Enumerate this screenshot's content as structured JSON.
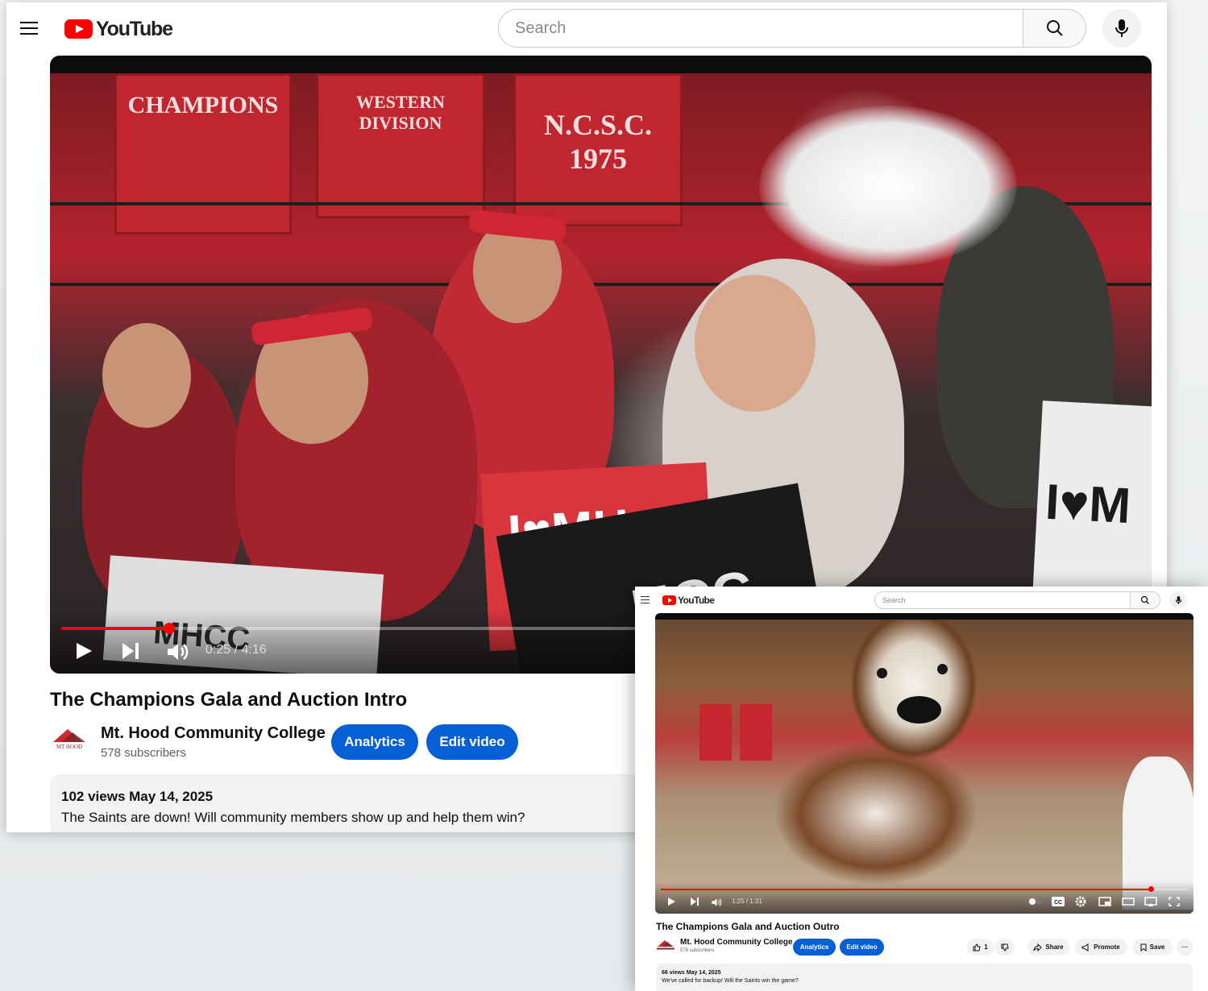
{
  "main_window": {
    "app": {
      "logo_text": "YouTube"
    },
    "search": {
      "placeholder": "Search"
    },
    "player": {
      "time_display": "0:25 / 4:16",
      "progress": 0.1
    },
    "video": {
      "title": "The Champions Gala and Auction Intro",
      "channel_name": "Mt. Hood Community College",
      "subscribers": "578 subscribers",
      "analytics_label": "Analytics",
      "edit_label": "Edit video",
      "meta": "102 views  May 14, 2025",
      "description": "The Saints are down! Will community members show up and help them win?"
    },
    "scene_text": {
      "banner1": "CHAMPIONS",
      "banner2": "WESTERN DIVISION",
      "banner3": "N.C.S.C. 1975",
      "sign1": "I♥MH",
      "sign2": "HCC",
      "sign3": "I♥M",
      "sign4": "MHCC"
    }
  },
  "overlay_window": {
    "app": {
      "logo_text": "YouTube"
    },
    "search": {
      "placeholder": "Search"
    },
    "player": {
      "time_display": "1:25 / 1:31",
      "progress": 0.93,
      "cc_label": "CC"
    },
    "video": {
      "title": "The Champions Gala and Auction Outro",
      "channel_name": "Mt. Hood Community College",
      "subscribers": "578 subscribers",
      "analytics_label": "Analytics",
      "edit_label": "Edit video",
      "likes": "1",
      "share_label": "Share",
      "promote_label": "Promote",
      "save_label": "Save",
      "more_label": "···",
      "meta": "66 views  May 14, 2025",
      "description": "We've called for backup! Will the Saints win the game?"
    }
  },
  "colors": {
    "brand_red": "#ff0000",
    "button_blue": "#065fd4",
    "desc_bg": "#f2f2f2"
  }
}
